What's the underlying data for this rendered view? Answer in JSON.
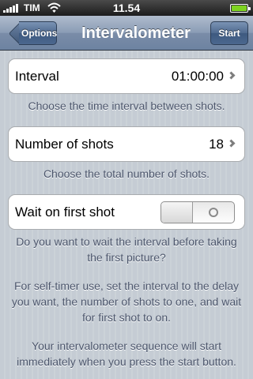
{
  "status_bar": {
    "carrier": "TIM",
    "time": "11.54",
    "battery_level": 1.0,
    "battery_color": "#7ed321"
  },
  "nav": {
    "back_label": "Options",
    "title": "Intervalometer",
    "start_label": "Start"
  },
  "interval": {
    "label": "Interval",
    "value": "01:00:00",
    "footer": "Choose the time interval between shots."
  },
  "shots": {
    "label": "Number of shots",
    "value": "18",
    "footer": "Choose the total number of shots."
  },
  "wait": {
    "label": "Wait on first shot",
    "switch_on": false,
    "footer": "Do you want to wait the interval before taking the first picture?"
  },
  "help": {
    "self_timer": "For self-timer use, set the interval to the delay you want, the number of shots to one, and wait for first shot to on.",
    "start_info": "Your intervalometer sequence will start immediately when you press the start button."
  },
  "icons": {
    "signal": "signal-bars-icon",
    "wifi": "wifi-icon",
    "battery": "battery-icon",
    "chevron": "chevron-right-icon",
    "back": "back-arrow-icon"
  }
}
